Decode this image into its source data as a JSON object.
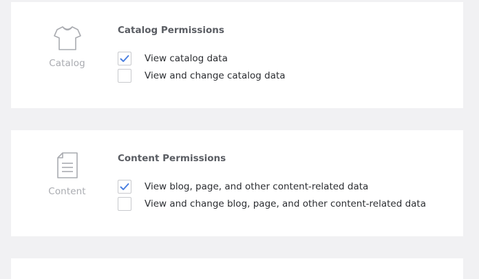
{
  "sections": [
    {
      "icon": "shirt-icon",
      "icon_label": "Catalog",
      "title": "Catalog Permissions",
      "permissions": [
        {
          "label": "View catalog data",
          "checked": true
        },
        {
          "label": "View and change catalog data",
          "checked": false
        }
      ]
    },
    {
      "icon": "document-icon",
      "icon_label": "Content",
      "title": "Content Permissions",
      "permissions": [
        {
          "label": "View blog, page, and other content-related data",
          "checked": true
        },
        {
          "label": "View and change blog, page, and other content-related data",
          "checked": false
        }
      ]
    }
  ],
  "colors": {
    "check_accent": "#4a7fe0",
    "muted_icon": "#a9abb0",
    "page_bg": "#f1f1f3"
  }
}
